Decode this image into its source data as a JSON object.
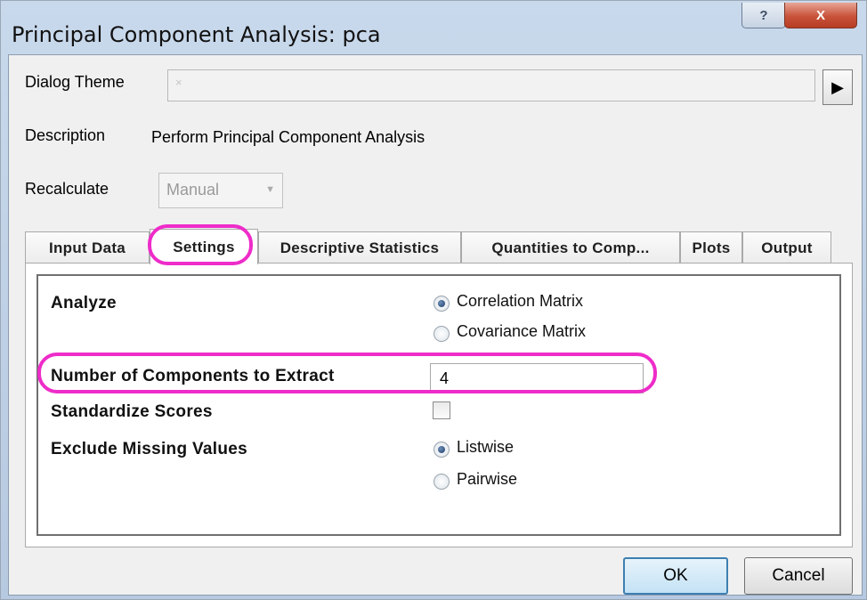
{
  "window": {
    "title": "Principal Component Analysis: pca",
    "help_glyph": "?",
    "close_glyph": "X"
  },
  "header": {
    "dialog_theme_label": "Dialog Theme",
    "dialog_theme_value": "×",
    "theme_arrow_glyph": "▶",
    "description_label": "Description",
    "description_value": "Perform Principal Component Analysis",
    "recalculate_label": "Recalculate",
    "recalculate_value": "Manual",
    "recalculate_chevron": "▼"
  },
  "tabs": [
    {
      "label": "Input Data"
    },
    {
      "label": "Settings"
    },
    {
      "label": "Descriptive Statistics"
    },
    {
      "label": "Quantities to Comp..."
    },
    {
      "label": "Plots"
    },
    {
      "label": "Output"
    }
  ],
  "active_tab": "Settings",
  "settings": {
    "analyze_label": "Analyze",
    "analyze_options": [
      {
        "label": "Correlation Matrix",
        "selected": true
      },
      {
        "label": "Covariance Matrix",
        "selected": false
      }
    ],
    "num_components_label": "Number of Components to Extract",
    "num_components_value": "4",
    "standardize_label": "Standardize Scores",
    "standardize_checked": false,
    "exclude_label": "Exclude Missing Values",
    "exclude_options": [
      {
        "label": "Listwise",
        "selected": true
      },
      {
        "label": "Pairwise",
        "selected": false
      }
    ]
  },
  "buttons": {
    "ok": "OK",
    "cancel": "Cancel"
  },
  "colors": {
    "highlight": "#ee2cc9",
    "titlebar": "#c9d9ec"
  }
}
